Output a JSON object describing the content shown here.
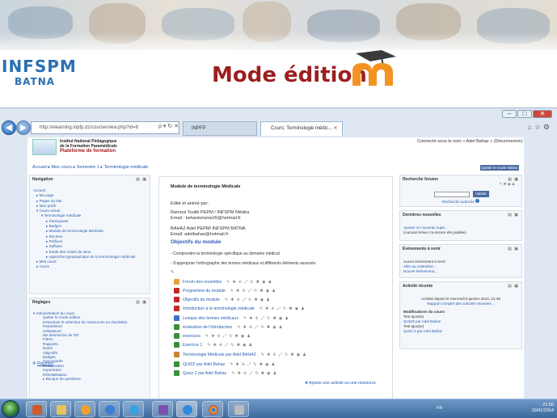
{
  "slide": {
    "title": "Mode édition",
    "logo_text": "INFSPM",
    "logo_subtext": "BATNA"
  },
  "browser": {
    "url": "http://elearning.inpfp.dz/course/view.php?id=8",
    "addr_tools": "ρ ▾ ↻ ✕",
    "tabs": [
      {
        "label": "INPFP"
      },
      {
        "label": "Cours: Terminologie médic...",
        "close": "✕"
      }
    ]
  },
  "site": {
    "institute_line1": "Institut National Pédagogique",
    "institute_line2": "de la Formation Paramédicale",
    "platform": "Plateforme de formation",
    "logged_in": "Connecté sous le nom « Adel Bahaz » (Déconnexion)",
    "breadcrumb": "Accueil ▸ Mes cours ▸ Semestre 1 ▸ Terminologie médicale",
    "edit_button": "Quitter le mode édition"
  },
  "navigation": {
    "title": "Navigation",
    "items": [
      "Accueil",
      "▸ Ma page",
      "▸ Pages du site",
      "▸ Mon profil",
      "▾ Cours actuel",
      "▾ Terminologie médicale",
      "▸ Participants",
      "▸ Badges",
      "▸ Module de terminologie Médicale",
      "▸ Racines",
      "▸ Préfixes",
      "▸ Suffixes",
      "▸ Etude des unités de sens",
      "▸ Approche typographique de la terminologie médicale",
      "▸ Mes cours",
      "▸ Cours"
    ]
  },
  "settings": {
    "title": "Réglages",
    "items": [
      "▾ Administration du cours",
      "Quitter le mode édition",
      "Désactiver le sélecteur de ressources ou d'activités",
      "Paramètres",
      "Utilisateurs",
      "Me désinscrire de TM",
      "Filtres",
      "Rapports",
      "Notes",
      "Objectifs",
      "Badges",
      "Sauvegarde",
      "Restauration",
      "Importation",
      "Réinitialisation",
      "▸ Banque de questions"
    ]
  },
  "main": {
    "module_title": "Module de terminologie Médicale",
    "edited_by": "Edité et animé par:",
    "author1_name": "Ramoul Toufik PEPM / INFSPM Médéa",
    "author1_email": "Email : behaviorisme26@hotmail.fr",
    "author2_name": "BAHAZ Adel PEPM/ INFSPM  BATNA",
    "author2_email": "Email: adelbahaz@hotmail.fr",
    "objectives_heading": "Objectifs du module",
    "objective1": "- Comprendre la terminologie spécifique au domaine médical",
    "objective2": "- S'approprier l'orthographe des termes médicaux et différents éléments associés",
    "tools_icons": "✎ ✚ ✢ ⤢ ↻ ✖ ◉ ♟",
    "activities": [
      {
        "label": "Forum des nouvelles",
        "icon": "forum-icon",
        "color": "#e8a13a"
      },
      {
        "label": "Programme du module",
        "icon": "pdf-icon",
        "color": "#c62828"
      },
      {
        "label": "Objectifs du module",
        "icon": "pdf-icon",
        "color": "#c62828"
      },
      {
        "label": "Introduction à la terminologie médicale",
        "icon": "pdf-icon",
        "color": "#c62828"
      },
      {
        "label": "Lexique des termes médicaux",
        "icon": "glossary-icon",
        "color": "#3b74c4"
      },
      {
        "label": "évaluation de l'introduction",
        "icon": "quiz-icon",
        "color": "#3a8f3a"
      },
      {
        "label": "exercices",
        "icon": "quiz-icon",
        "color": "#3a8f3a"
      },
      {
        "label": "Exercice 1",
        "icon": "quiz-icon",
        "color": "#3a8f3a"
      },
      {
        "label": "Terminologie Médicale par Adel BAHAZ",
        "icon": "book-icon",
        "color": "#c9822f"
      },
      {
        "label": "QUIZZ par Adel Bahaz",
        "icon": "quiz-icon",
        "color": "#3a8f3a"
      },
      {
        "label": "Quizz 2 par Adel Bahaz",
        "icon": "quiz-icon",
        "color": "#3a8f3a"
      }
    ],
    "add_activity": "✚ Ajouter une activité ou une ressource",
    "next_section": "Racines"
  },
  "right": {
    "search": {
      "title": "Recherche forums",
      "button": "Valider",
      "advanced": "Recherche avancée"
    },
    "news": {
      "title": "Dernières nouvelles",
      "add": "Ajouter un nouveau sujet...",
      "none": "(Aucune brève n'a encore été publiée)"
    },
    "events": {
      "title": "Événements à venir",
      "none": "Aucun événement à venir",
      "calendar": "Aller au calendrier...",
      "new_event": "Nouvel événement..."
    },
    "activity": {
      "title": "Activité récente",
      "since": "Activité depuis le mercredi 8 janvier 2014, 21:49",
      "report": "Rapport complet des activités récentes...",
      "mods_title": "Modifications du cours:",
      "mod1_label": "Test ajout(e)",
      "mod1_link": "QUIZZ par Adel Bahaz",
      "mod2_label": "Test ajout(e)",
      "mod2_link": "Quizz 2 par Adel Bahaz"
    }
  },
  "taskbar": {
    "lang": "FR",
    "time": "21:50",
    "date": "10/01/2014"
  }
}
